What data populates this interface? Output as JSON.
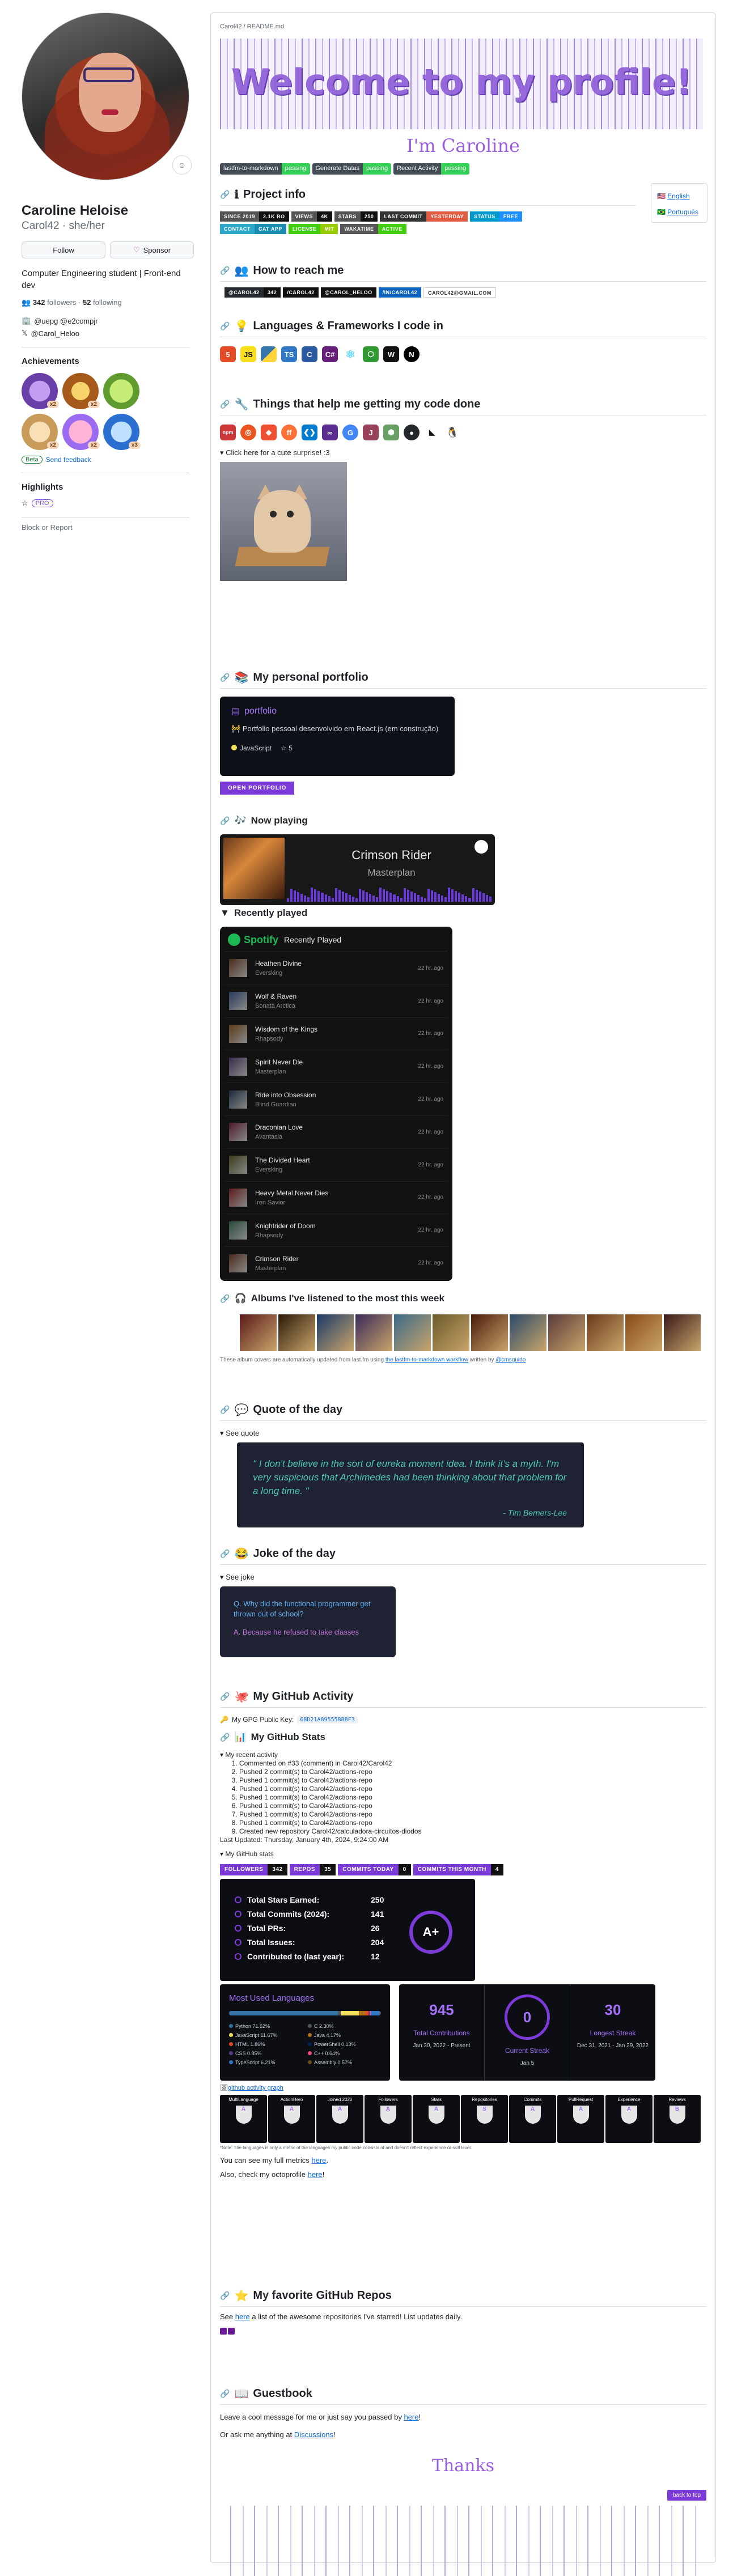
{
  "profile": {
    "name": "Caroline Heloise",
    "login": "Carol42",
    "pronouns": "she/her",
    "follow_label": "Follow",
    "sponsor_label": "Sponsor",
    "bio": "Computer Engineering student | Front-end dev",
    "followers_count": "342",
    "followers_label": "followers",
    "following_count": "52",
    "following_label": "following",
    "company": "@uepg @e2compjr",
    "twitter": "@Carol_Heloo",
    "achievements_title": "Achievements",
    "achievement_counts": [
      "x2",
      "x2",
      "",
      "x2",
      "x2",
      "x3"
    ],
    "beta_label": "Beta",
    "feedback_label": "Send feedback",
    "highlights_title": "Highlights",
    "pro_label": "PRO",
    "block_label": "Block or Report"
  },
  "readme": {
    "breadcrumb": "Carol42 / README.md",
    "hero_title": "Welcome to my profile!",
    "hero_sub": "I'm Caroline",
    "workflows": [
      {
        "name": "lastfm-to-markdown",
        "status": "passing"
      },
      {
        "name": "Generate Datas",
        "status": "passing"
      },
      {
        "name": "Recent Activity",
        "status": "passing"
      }
    ],
    "languages": [
      "English",
      "Português"
    ],
    "sections": {
      "project_info": "Project info",
      "reach": "How to reach me",
      "languages": "Languages & Frameworks I code in",
      "tools": "Things that help me getting my code done",
      "portfolio": "My personal portfolio",
      "now_playing": "Now playing",
      "recently_played": "Recently played",
      "albums": "Albums I've listened to the most this week",
      "quote": "Quote of the day",
      "joke": "Joke of the day",
      "activity": "My GitHub Activity",
      "stats": "My GitHub Stats",
      "repos": "My favorite GitHub Repos",
      "guestbook": "Guestbook"
    },
    "project_shields": [
      [
        "SINCE 2019",
        "2.1K RO"
      ],
      [
        "VIEWS",
        "4K"
      ],
      [
        "STARS",
        "250"
      ],
      [
        "LAST COMMIT",
        "YESTERDAY"
      ],
      [
        "STATUS",
        "FREE"
      ]
    ],
    "project_shields2": [
      [
        "CONTACT",
        "CAT APP"
      ],
      [
        "LICENSE",
        "MIT"
      ],
      [
        "WAKATIME",
        "ACTIVE"
      ]
    ],
    "contact_shields": [
      [
        "@CAROL42",
        "342"
      ],
      [
        "/CAROL42",
        ""
      ],
      [
        "@CAROL_HELOO",
        ""
      ],
      [
        "/IN/CAROL42",
        ""
      ],
      [
        "CAROL42@GMAIL.COM",
        ""
      ]
    ],
    "tech_icons": [
      "html5-icon",
      "javascript-icon",
      "python-icon",
      "typescript-icon",
      "c-icon",
      "csharp-icon",
      "react-icon",
      "nodejs-icon",
      "windicss-icon",
      "nextjs-icon"
    ],
    "tool_icons": [
      "npm-icon",
      "ubuntu-icon",
      "git-icon",
      "firefox-icon",
      "vscode-icon",
      "visual-studio-icon",
      "google-icon",
      "jest-icon",
      "postman-icon",
      "github-icon",
      "wakatime-icon",
      "linux-icon"
    ],
    "cat_summary": "Click here for a cute surprise! :3",
    "portfolio": {
      "repo": "portfolio",
      "desc": "Portfolio pessoal desenvolvido em React.js (em construção)",
      "lang": "JavaScript",
      "stars": "5",
      "button": "OPEN PORTFOLIO"
    },
    "now_playing": {
      "title": "Crimson Rider",
      "artist": "Masterplan"
    },
    "recent": {
      "brand": "Spotify",
      "header": "Recently Played",
      "tracks": [
        {
          "title": "Heathen Divine",
          "artist": "Eversking",
          "ago": "22 hr. ago"
        },
        {
          "title": "Wolf & Raven",
          "artist": "Sonata Arctica",
          "ago": "22 hr. ago"
        },
        {
          "title": "Wisdom of the Kings",
          "artist": "Rhapsody",
          "ago": "22 hr. ago"
        },
        {
          "title": "Spirit Never Die",
          "artist": "Masterplan",
          "ago": "22 hr. ago"
        },
        {
          "title": "Ride into Obsession",
          "artist": "Blind Guardian",
          "ago": "22 hr. ago"
        },
        {
          "title": "Draconian Love",
          "artist": "Avantasia",
          "ago": "22 hr. ago"
        },
        {
          "title": "The Divided Heart",
          "artist": "Eversking",
          "ago": "22 hr. ago"
        },
        {
          "title": "Heavy Metal Never Dies",
          "artist": "Iron Savior",
          "ago": "22 hr. ago"
        },
        {
          "title": "Knightrider of Doom",
          "artist": "Rhapsody",
          "ago": "22 hr. ago"
        },
        {
          "title": "Crimson Rider",
          "artist": "Masterplan",
          "ago": "22 hr. ago"
        }
      ]
    },
    "albums_note_pre": "These album covers are automatically updated from last.fm using",
    "albums_note_link": "the lastfm-to-markdown workflow",
    "albums_note_mid": "written by",
    "albums_note_author": "@cmsguido",
    "quote": {
      "summary": "See quote",
      "text": "\" I don't believe in the sort of eureka moment idea. I think it's a myth. I'm very suspicious that Archimedes had been thinking about that problem for a long time. \"",
      "author": "- Tim Berners-Lee"
    },
    "joke": {
      "summary": "See joke",
      "q": "Q. Why did the functional programmer get thrown out of school?",
      "a": "A. Because he refused to take classes"
    },
    "gpg_label": "My GPG Public Key:",
    "gpg_key": "6BD21A89555BBBF3",
    "activity_summary": "My recent activity",
    "activity_items": [
      "Commented on #33 (comment) in Carol42/Carol42",
      "Pushed 2 commit(s) to Carol42/actions-repo",
      "Pushed 1 commit(s) to Carol42/actions-repo",
      "Pushed 1 commit(s) to Carol42/actions-repo",
      "Pushed 1 commit(s) to Carol42/actions-repo",
      "Pushed 1 commit(s) to Carol42/actions-repo",
      "Pushed 1 commit(s) to Carol42/actions-repo",
      "Pushed 1 commit(s) to Carol42/actions-repo",
      "Created new repository Carol42/calculadora-circuitos-diodos"
    ],
    "last_updated": "Last Updated: Thursday, January 4th, 2024, 9:24:00 AM",
    "stats_summary": "My GitHub stats",
    "stat_shields": [
      [
        "FOLLOWERS",
        "342"
      ],
      [
        "REPOS",
        "35"
      ],
      [
        "COMMITS TODAY",
        "0"
      ],
      [
        "COMMITS THIS MONTH",
        "4"
      ]
    ],
    "stats": {
      "rows": [
        {
          "k": "Total Stars Earned:",
          "v": "250"
        },
        {
          "k": "Total Commits (2024):",
          "v": "141"
        },
        {
          "k": "Total PRs:",
          "v": "26"
        },
        {
          "k": "Total Issues:",
          "v": "204"
        },
        {
          "k": "Contributed to (last year):",
          "v": "12"
        }
      ],
      "rank": "A+"
    },
    "langs": {
      "title": "Most Used Languages",
      "items": [
        {
          "name": "Python 71.62%",
          "color": "#3572A5",
          "pct": 71.62
        },
        {
          "name": "C 2.30%",
          "color": "#555555",
          "pct": 2.3
        },
        {
          "name": "JavaScript 11.67%",
          "color": "#f1e05a",
          "pct": 11.67
        },
        {
          "name": "Java 4.17%",
          "color": "#b07219",
          "pct": 4.17
        },
        {
          "name": "HTML 1.86%",
          "color": "#e34c26",
          "pct": 1.86
        },
        {
          "name": "PowerShell 0.13%",
          "color": "#012456",
          "pct": 0.13
        },
        {
          "name": "CSS 0.85%",
          "color": "#563d7c",
          "pct": 0.85
        },
        {
          "name": "C++ 0.64%",
          "color": "#f34b7d",
          "pct": 0.64
        },
        {
          "name": "TypeScript 6.21%",
          "color": "#3178c6",
          "pct": 6.21
        },
        {
          "name": "Assembly 0.57%",
          "color": "#6E4C13",
          "pct": 0.57
        }
      ]
    },
    "streak": {
      "total": "945",
      "total_l": "Total Contributions",
      "total_r": "Jan 30, 2022 - Present",
      "current": "0",
      "current_l": "Current Streak",
      "current_r": "Jan 5",
      "longest": "30",
      "longest_l": "Longest Streak",
      "longest_r": "Dec 31, 2021 - Jan 29, 2022"
    },
    "graph_alt": "github activity graph",
    "trophies": [
      "MultiLanguage",
      "ActionHero",
      "Joined 2020",
      "Followers",
      "Stars",
      "Repositories",
      "Commits",
      "PullRequest",
      "Experience",
      "Reviews"
    ],
    "trophy_grades": [
      "A",
      "A",
      "A",
      "A",
      "A",
      "S",
      "A",
      "A",
      "A",
      "B"
    ],
    "trophy_note": "*Note: The languages is only a metric of the languages my public code consists of and doesn't reflect experience or skill level.",
    "metrics_pre": "You can see my full metrics",
    "metrics_link": "here",
    "octo_pre": "Also, check my octoprofile",
    "octo_link": "here",
    "repos_pre": "See",
    "repos_link": "here",
    "repos_post": "a list of the awesome repositories I've starred! List updates daily.",
    "guest_pre": "Leave a cool message for me or just say you passed by",
    "guest_link": "here",
    "disc_pre": "Or ask me anything at",
    "disc_link": "Discussions",
    "thanks": "Thanks",
    "back_to_top": "back to top"
  }
}
